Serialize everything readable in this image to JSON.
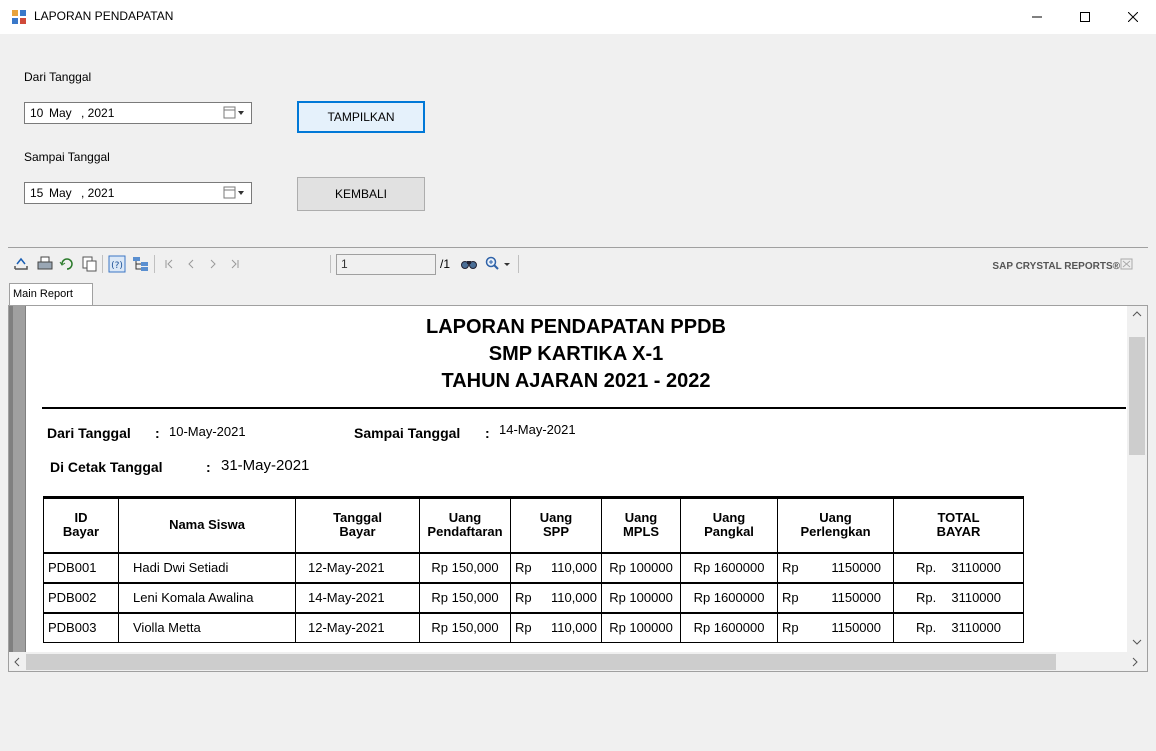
{
  "window": {
    "title": "LAPORAN PENDAPATAN"
  },
  "form": {
    "dari_label": "Dari Tanggal",
    "dari_day": "10",
    "dari_month": "May",
    "dari_year": ", 2021",
    "sampai_label": "Sampai Tanggal",
    "sampai_day": "15",
    "sampai_month": "May",
    "sampai_year": ", 2021",
    "tampilkan_label": "TAMPILKAN",
    "kembali_label": "KEMBALI"
  },
  "viewer": {
    "page_value": "1",
    "page_total": "/1",
    "brand": "SAP CRYSTAL REPORTS®",
    "tab_label": "Main Report"
  },
  "report": {
    "title1": "LAPORAN PENDAPATAN PPDB",
    "title2": "SMP KARTIKA X-1",
    "title3": "TAHUN AJARAN 2021 - 2022",
    "dari_label": "Dari Tanggal",
    "dari_value": "10-May-2021",
    "sampai_label": "Sampai Tanggal",
    "sampai_value": "14-May-2021",
    "cetak_label": "Di Cetak Tanggal",
    "cetak_value": "31-May-2021",
    "colon": ":",
    "headers": {
      "id_1": "ID",
      "id_2": "Bayar",
      "nama": "Nama Siswa",
      "tgl_1": "Tanggal",
      "tgl_2": "Bayar",
      "daftar_1": "Uang",
      "daftar_2": "Pendaftaran",
      "spp_1": "Uang",
      "spp_2": "SPP",
      "mpls_1": "Uang",
      "mpls_2": "MPLS",
      "pangkal_1": "Uang",
      "pangkal_2": "Pangkal",
      "perl_1": "Uang",
      "perl_2": "Perlengkan",
      "total_1": "TOTAL",
      "total_2": "BAYAR"
    },
    "rows": [
      {
        "id": "PDB001",
        "nama": "Hadi Dwi Setiadi",
        "tanggal": "12-May-2021",
        "daftar": "Rp 150,000",
        "spp_cur": "Rp",
        "spp": "110,000",
        "mpls": "Rp 100000",
        "pangkal": "Rp 1600000",
        "perl_cur": "Rp",
        "perl": "1150000",
        "total_cur": "Rp.",
        "total": "3110000"
      },
      {
        "id": "PDB002",
        "nama": "Leni Komala Awalina",
        "tanggal": "14-May-2021",
        "daftar": "Rp 150,000",
        "spp_cur": "Rp",
        "spp": "110,000",
        "mpls": "Rp 100000",
        "pangkal": "Rp 1600000",
        "perl_cur": "Rp",
        "perl": "1150000",
        "total_cur": "Rp.",
        "total": "3110000"
      },
      {
        "id": "PDB003",
        "nama": "Violla Metta",
        "tanggal": "12-May-2021",
        "daftar": "Rp 150,000",
        "spp_cur": "Rp",
        "spp": "110,000",
        "mpls": "Rp 100000",
        "pangkal": "Rp 1600000",
        "perl_cur": "Rp",
        "perl": "1150000",
        "total_cur": "Rp.",
        "total": "3110000"
      }
    ]
  }
}
